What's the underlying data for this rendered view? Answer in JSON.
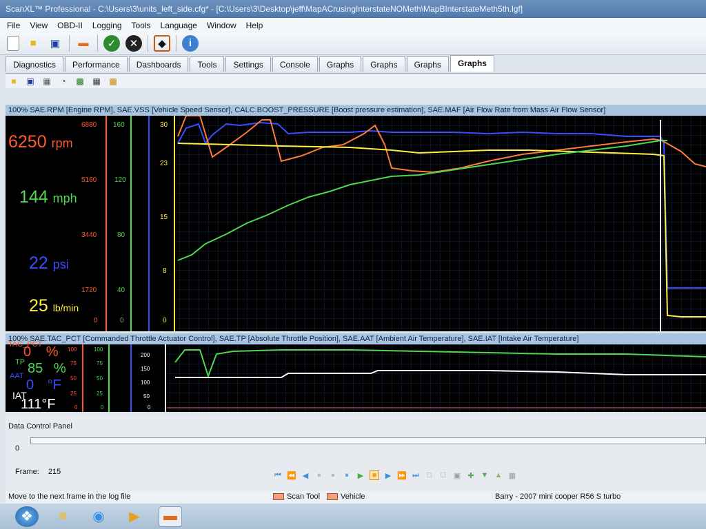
{
  "window": {
    "title": "ScanXL™ Professional - C:\\Users\\3\\units_left_side.cfg* - [C:\\Users\\3\\Desktop\\jeff\\MapACrusingInterstateNOMeth\\MapBInterstateMeth5th.lgf]"
  },
  "menu": [
    "File",
    "View",
    "OBD-II",
    "Logging",
    "Tools",
    "Language",
    "Window",
    "Help"
  ],
  "toolbar_icons": [
    "new-file-icon",
    "open-folder-icon",
    "save-disk-icon",
    "vehicle-icon",
    "connect-icon",
    "disconnect-icon",
    "settings-icon",
    "info-icon"
  ],
  "tabs": [
    "Diagnostics",
    "Performance",
    "Dashboards",
    "Tools",
    "Settings",
    "Console",
    "Graphs",
    "Graphs",
    "Graphs",
    "Graphs"
  ],
  "active_tab_index": 9,
  "graph1": {
    "header": "100% SAE.RPM [Engine RPM], SAE.VSS [Vehicle Speed Sensor], CALC.BOOST_PRESSURE [Boost pressure estimation], SAE.MAF [Air Flow Rate from Mass Air Flow Sensor]",
    "readouts": [
      {
        "value": "6250",
        "unit": "rpm",
        "color": "#ff5a2a"
      },
      {
        "value": "144",
        "unit": "mph",
        "color": "#4fd84f"
      },
      {
        "value": "22",
        "unit": "psi",
        "color": "#3a4cff"
      },
      {
        "value": "25",
        "unit": "lb/min",
        "color": "#ffee44"
      }
    ],
    "rpm_scale": [
      "6880",
      "5160",
      "3440",
      "1720",
      "0"
    ],
    "speed_scale": [
      "160",
      "120",
      "80",
      "40",
      "0"
    ],
    "boost_scale": [
      "30",
      "23",
      "15",
      "8",
      "0"
    ]
  },
  "graph2": {
    "header": "100% SAE.TAC_PCT [Commanded Throttle Actuator Control], SAE.TP [Absolute Throttle Position], SAE.AAT [Ambient Air Temperature], SAE.IAT [Intake Air Temperature]",
    "labels": [
      {
        "name": "TAC_PCT",
        "value": "0",
        "unit": "%",
        "color": "#ff5a2a"
      },
      {
        "name": "TP",
        "value": "85",
        "unit": "%",
        "color": "#4fd84f"
      },
      {
        "name": "AAT",
        "value": "0",
        "unit": "°F",
        "color": "#3a4cff"
      },
      {
        "name": "IAT",
        "value": "111",
        "unit": "°F",
        "color": "#ffffff"
      }
    ],
    "pct_scale": [
      "100",
      "75",
      "50",
      "25",
      "0"
    ],
    "temp_scale": [
      "200",
      "150",
      "100",
      "50",
      "0"
    ]
  },
  "control_panel": {
    "title": "Data Control Panel",
    "slider_value": "0",
    "frame_label": "Frame:",
    "frame_value": "215"
  },
  "status": {
    "hint": "Move to the next frame in the log file",
    "legend": [
      "Scan Tool",
      "Vehicle"
    ],
    "vehicle_info": "Barry - 2007 mini cooper R56  S turbo"
  },
  "colors": {
    "rpm": "#ff5a2a",
    "speed": "#4fd84f",
    "boost": "#3a4cff",
    "maf": "#ffee44",
    "grid": "#16254a"
  }
}
